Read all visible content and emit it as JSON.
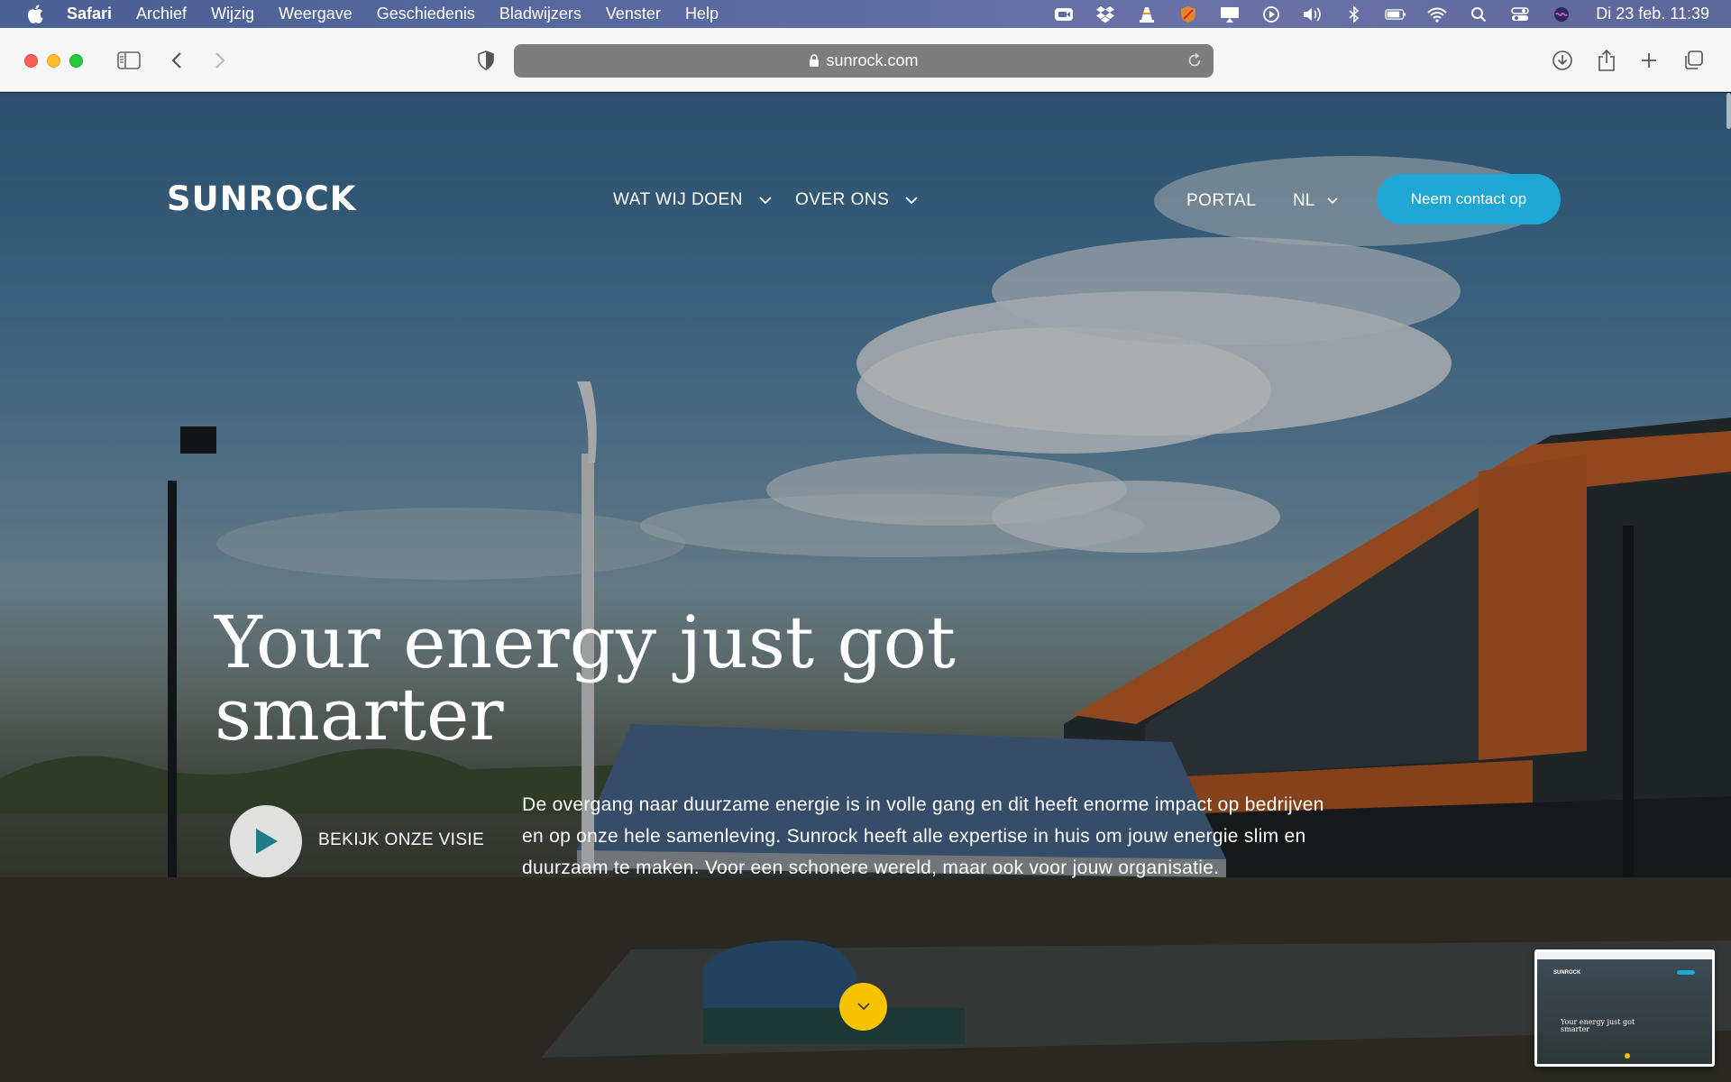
{
  "menubar": {
    "app_name": "Safari",
    "items": [
      "Archief",
      "Wijzig",
      "Weergave",
      "Geschiedenis",
      "Bladwijzers",
      "Venster",
      "Help"
    ],
    "clock": "Di 23 feb.  11:39"
  },
  "browser": {
    "url": "sunrock.com"
  },
  "site": {
    "logo": "SUNROCK",
    "nav": {
      "what_we_do": "WAT WIJ DOEN",
      "about_us": "OVER ONS",
      "portal": "PORTAL",
      "language": "NL",
      "contact": "Neem contact op"
    },
    "hero": {
      "title": "Your energy just got smarter",
      "video_label": "BEKIJK ONZE VISIE",
      "intro": "De overgang naar duurzame energie is in volle gang en dit heeft enorme impact op bedrijven en op onze hele samenleving. Sunrock heeft alle expertise in huis om jouw energie slim en duurzaam te maken. Voor een schonere wereld, maar ook voor jouw organisatie."
    },
    "thumbnail": {
      "logo": "SUNROCK",
      "title": "Your energy just got smarter"
    }
  },
  "colors": {
    "accent_blue": "#1ea7d5",
    "accent_yellow": "#f7c300"
  }
}
